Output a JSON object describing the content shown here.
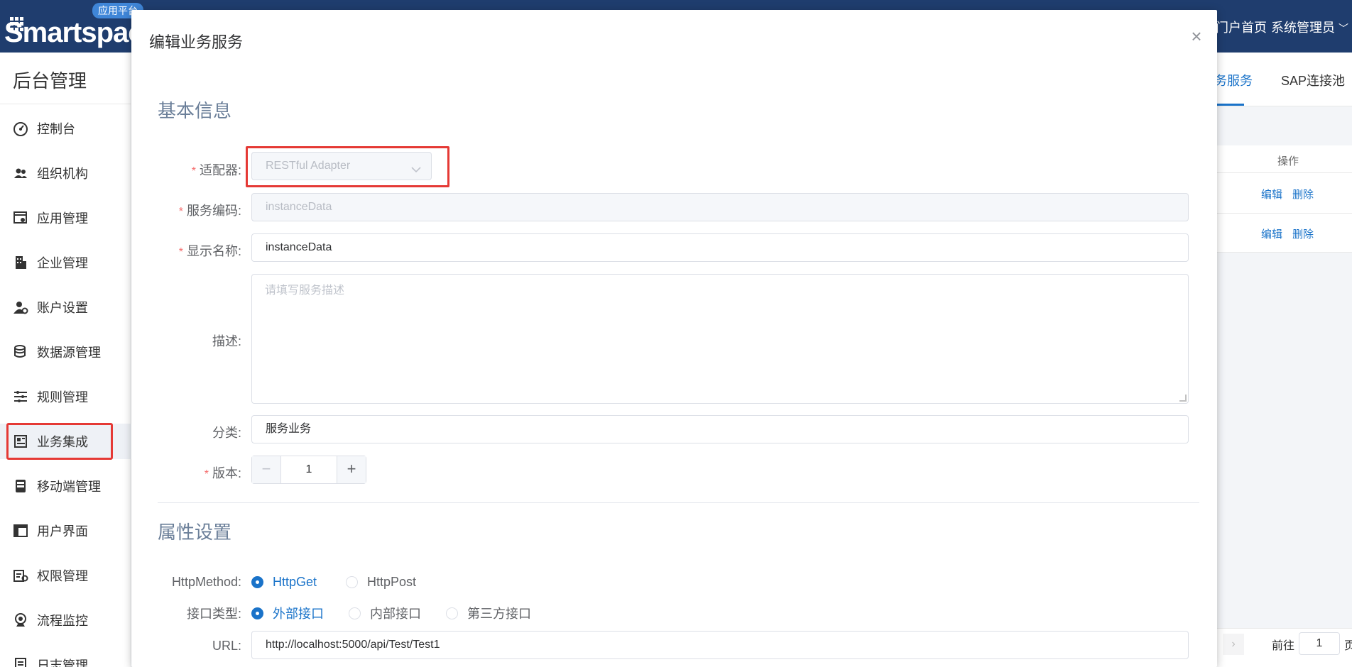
{
  "header": {
    "logo_text": "Smartspac",
    "logo_badge": "应用平台",
    "nav_home": "门户首页",
    "user_menu": "系统管理员"
  },
  "sidebar": {
    "title": "后台管理",
    "items": [
      {
        "label": "控制台",
        "icon": "dashboard-icon"
      },
      {
        "label": "组织机构",
        "icon": "users-icon"
      },
      {
        "label": "应用管理",
        "icon": "app-settings-icon"
      },
      {
        "label": "企业管理",
        "icon": "building-icon"
      },
      {
        "label": "账户设置",
        "icon": "user-settings-icon"
      },
      {
        "label": "数据源管理",
        "icon": "database-icon"
      },
      {
        "label": "规则管理",
        "icon": "rules-icon"
      },
      {
        "label": "业务集成",
        "icon": "integration-icon"
      },
      {
        "label": "移动端管理",
        "icon": "mobile-icon"
      },
      {
        "label": "用户界面",
        "icon": "layout-icon"
      },
      {
        "label": "权限管理",
        "icon": "permission-icon"
      },
      {
        "label": "流程监控",
        "icon": "monitor-icon"
      },
      {
        "label": "日志管理",
        "icon": "log-icon"
      }
    ],
    "active_index": 7
  },
  "background_page": {
    "tab_business_service": "务服务",
    "tab_sap_pool": "SAP连接池",
    "table_header_ops": "操作",
    "row_actions": [
      "编辑",
      "删除"
    ],
    "pager_goto": "前往",
    "pager_page": "1",
    "pager_suffix": "页"
  },
  "modal": {
    "title": "编辑业务服务",
    "close_symbol": "×",
    "section_basic": "基本信息",
    "section_props": "属性设置",
    "fields": {
      "adapter": {
        "label": "适配器:",
        "value": "RESTful Adapter",
        "required": true
      },
      "service_code": {
        "label": "服务编码:",
        "value": "instanceData",
        "required": true
      },
      "display_name": {
        "label": "显示名称:",
        "value": "instanceData",
        "required": true
      },
      "description": {
        "label": "描述:",
        "placeholder": "请填写服务描述",
        "value": ""
      },
      "category": {
        "label": "分类:",
        "value": "服务业务"
      },
      "version": {
        "label": "版本:",
        "value": "1",
        "minus": "−",
        "plus": "+",
        "required": true
      },
      "http_method": {
        "label": "HttpMethod:",
        "options": [
          "HttpGet",
          "HttpPost"
        ],
        "selected": "HttpGet"
      },
      "interface_type": {
        "label": "接口类型:",
        "options": [
          "外部接口",
          "内部接口",
          "第三方接口"
        ],
        "selected": "外部接口"
      },
      "url": {
        "label": "URL:",
        "value": "http://localhost:5000/api/Test/Test1"
      }
    },
    "required_mark": "*"
  },
  "colors": {
    "header_bg": "#1f3d6e",
    "accent": "#1a73c9",
    "required": "#f56c6c",
    "highlight_box": "#e53935"
  }
}
